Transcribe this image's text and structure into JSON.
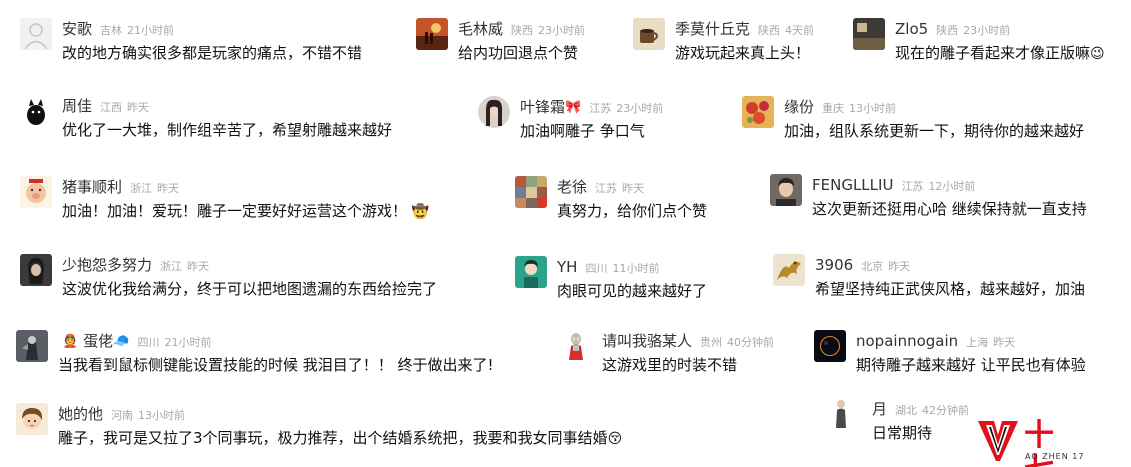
{
  "comments": [
    {
      "name": "安歌",
      "deco": "",
      "location": "吉林",
      "time": "21小时前",
      "text": "改的地方确实很多都是玩家的痛点，不错不错",
      "emoji": "",
      "avatar": "sketch-figure"
    },
    {
      "name": "毛林威",
      "deco": "",
      "location": "陕西",
      "time": "23小时前",
      "text": "给内功回退点个赞",
      "emoji": "",
      "avatar": "sunset-couple"
    },
    {
      "name": "季莫什丘克",
      "deco": "",
      "location": "陕西",
      "time": "4天前",
      "text": "游戏玩起来真上头！",
      "emoji": "",
      "avatar": "coffee-cup"
    },
    {
      "name": "Zlo5",
      "deco": "",
      "location": "陕西",
      "time": "23小时前",
      "text": "现在的雕子看起来才像正版嘛",
      "emoji": "😉",
      "avatar": "dark-room"
    },
    {
      "name": "周佳",
      "deco": "",
      "location": "江西",
      "time": "昨天",
      "text": "优化了一大堆，制作组辛苦了，希望射雕越来越好",
      "emoji": "",
      "avatar": "black-cat"
    },
    {
      "name": "叶锋霜",
      "deco": "🎀",
      "location": "江苏",
      "time": "23小时前",
      "text": "加油啊雕子 争口气",
      "emoji": "",
      "avatar": "portrait-woman"
    },
    {
      "name": "缘份",
      "deco": "",
      "location": "重庆",
      "time": "13小时前",
      "text": "加油，组队系统更新一下，期待你的越来越好",
      "emoji": "",
      "avatar": "flowers"
    },
    {
      "name": "猪事顺利",
      "deco": "",
      "location": "浙江",
      "time": "昨天",
      "text": "加油！加油！爱玩！雕子一定要好好运营这个游戏！",
      "emoji": "🤠",
      "avatar": "cartoon-pig"
    },
    {
      "name": "老徐",
      "deco": "",
      "location": "江苏",
      "time": "昨天",
      "text": "真努力，给你们点个赞",
      "emoji": "",
      "avatar": "mosaic-flag"
    },
    {
      "name": "FENGLLLIU",
      "deco": "",
      "location": "江苏",
      "time": "12小时前",
      "text": "这次更新还挺用心哈 继续保持就一直支持",
      "emoji": "",
      "avatar": "young-man"
    },
    {
      "name": "少抱怨多努力",
      "deco": "",
      "location": "浙江",
      "time": "昨天",
      "text": "这波优化我给满分，终于可以把地图遗漏的东西给捡完了",
      "emoji": "",
      "avatar": "dark-portrait"
    },
    {
      "name": "YH",
      "deco": "",
      "location": "四川",
      "time": "11小时前",
      "text": "肉眼可见的越来越好了",
      "emoji": "",
      "avatar": "teal-character"
    },
    {
      "name": "3906",
      "deco": "",
      "location": "北京",
      "time": "昨天",
      "text": "希望坚持纯正武侠风格，越来越好，加油",
      "emoji": "",
      "avatar": "golden-dragon"
    },
    {
      "name": "蛋佬",
      "deco": "👲",
      "location": "四川",
      "time": "21小时前",
      "text": "当我看到鼠标侧键能设置技能的时候 我泪目了！！ 终于做出来了!",
      "emoji": "",
      "avatar": "armored-warrior",
      "trail": "🧢"
    },
    {
      "name": "请叫我骆某人",
      "deco": "",
      "location": "贵州",
      "time": "40分钟前",
      "text": "这游戏里的时装不错",
      "emoji": "",
      "avatar": "ultraman"
    },
    {
      "name": "nopainnogain",
      "deco": "",
      "location": "上海",
      "time": "昨天",
      "text": "期待雕子越来越好 让平民也有体验",
      "emoji": "",
      "avatar": "eclipse"
    },
    {
      "name": "她的他",
      "deco": "",
      "location": "河南",
      "time": "13小时前",
      "text": "雕子，我可是又拉了3个同事玩，极力推荐，出个结婚系统把，我要和我女同事结婚",
      "emoji": "😚",
      "avatar": "cartoon-girl"
    },
    {
      "name": "月",
      "deco": "",
      "location": "湖北",
      "time": "42分钟前",
      "text": "日常期待",
      "emoji": "",
      "avatar": "standing-figure"
    }
  ],
  "logo": {
    "cn": "十七",
    "en": "AO ZHEN 17",
    "color": "#e1101a"
  },
  "colors": {
    "name": "#333333",
    "meta": "#a8a8a8",
    "text": "#111111",
    "background": "#ffffff"
  }
}
